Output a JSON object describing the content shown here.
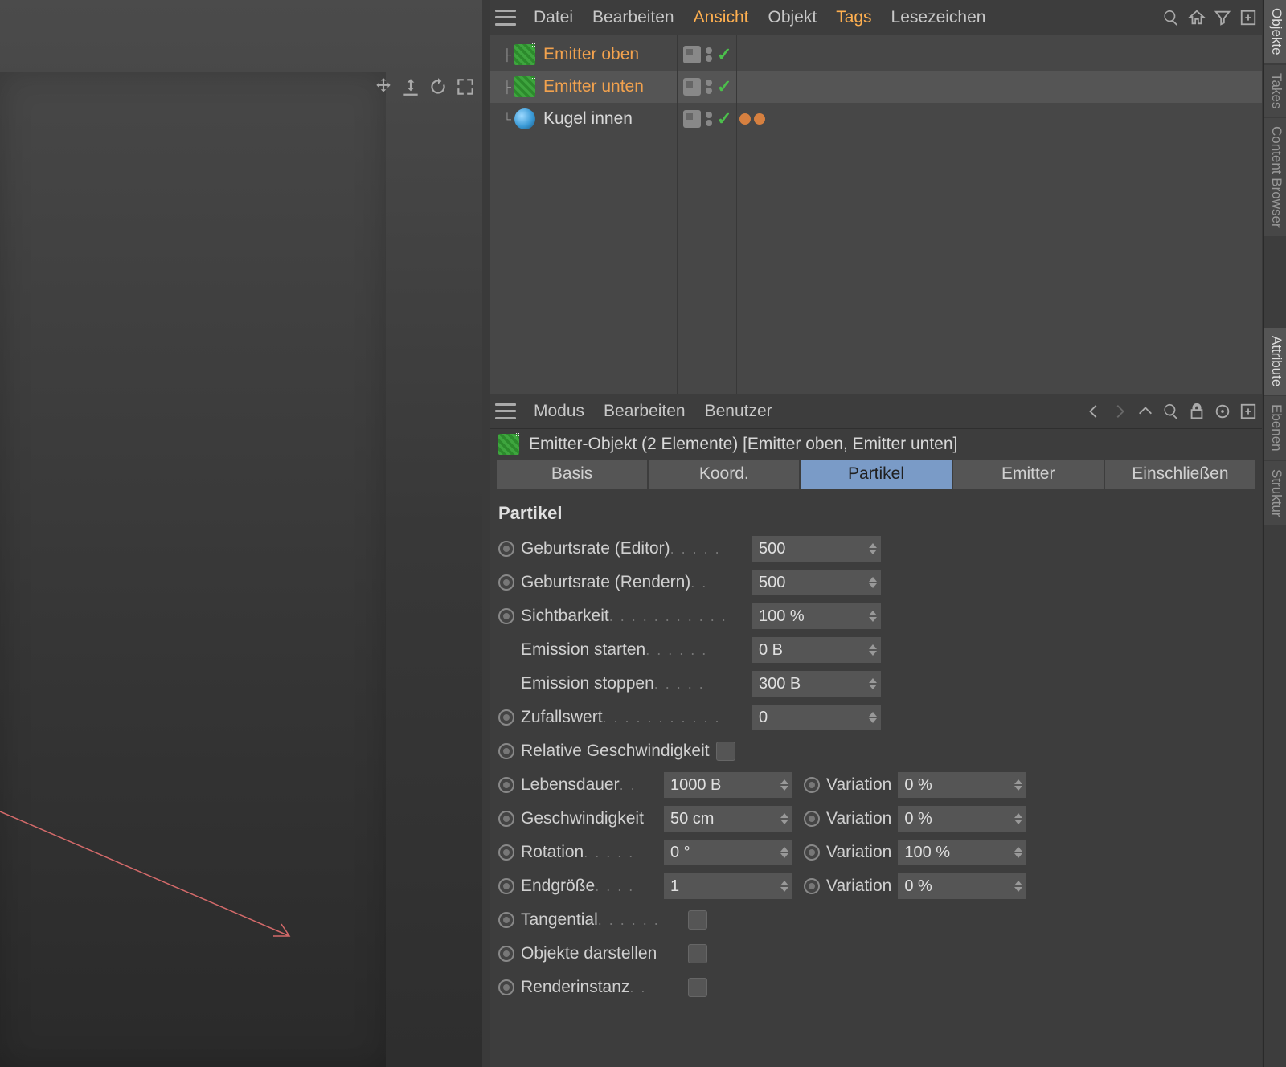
{
  "objManager": {
    "menu": {
      "datei": "Datei",
      "bearbeiten": "Bearbeiten",
      "ansicht": "Ansicht",
      "objekt": "Objekt",
      "tags": "Tags",
      "lesezeichen": "Lesezeichen"
    },
    "items": [
      {
        "name": "Emitter oben",
        "type": "emitter",
        "selected": false
      },
      {
        "name": "Emitter unten",
        "type": "emitter",
        "selected": true
      },
      {
        "name": "Kugel innen",
        "type": "sphere",
        "selected": false,
        "tags": 2
      }
    ]
  },
  "attrManager": {
    "menu": {
      "modus": "Modus",
      "bearbeiten": "Bearbeiten",
      "benutzer": "Benutzer"
    },
    "title": "Emitter-Objekt (2 Elemente) [Emitter oben, Emitter unten]",
    "tabs": {
      "basis": "Basis",
      "koord": "Koord.",
      "partikel": "Partikel",
      "emitter": "Emitter",
      "einschliessen": "Einschließen"
    },
    "section": "Partikel",
    "params": {
      "geburtsrate_editor": {
        "label": "Geburtsrate (Editor)",
        "value": "500"
      },
      "geburtsrate_rendern": {
        "label": "Geburtsrate (Rendern)",
        "value": "500"
      },
      "sichtbarkeit": {
        "label": "Sichtbarkeit",
        "value": "100 %"
      },
      "emission_starten": {
        "label": "Emission starten",
        "value": "0 B"
      },
      "emission_stoppen": {
        "label": "Emission stoppen",
        "value": "300 B"
      },
      "zufallswert": {
        "label": "Zufallswert",
        "value": "0"
      },
      "relative_geschwindigkeit": {
        "label": "Relative Geschwindigkeit"
      },
      "lebensdauer": {
        "label": "Lebensdauer",
        "value": "1000 B",
        "varLabel": "Variation",
        "varValue": "0 %"
      },
      "geschwindigkeit": {
        "label": "Geschwindigkeit",
        "value": "50 cm",
        "varLabel": "Variation",
        "varValue": "0 %"
      },
      "rotation": {
        "label": "Rotation",
        "value": "0 °",
        "varLabel": "Variation",
        "varValue": "100 %"
      },
      "endgroesse": {
        "label": "Endgröße",
        "value": "1",
        "varLabel": "Variation",
        "varValue": "0 %"
      },
      "tangential": {
        "label": "Tangential"
      },
      "objekte_darstellen": {
        "label": "Objekte darstellen"
      },
      "renderinstanz": {
        "label": "Renderinstanz"
      }
    }
  },
  "sideTabs": {
    "objekte": "Objekte",
    "takes": "Takes",
    "content_browser": "Content Browser",
    "attribute": "Attribute",
    "ebenen": "Ebenen",
    "struktur": "Struktur"
  }
}
